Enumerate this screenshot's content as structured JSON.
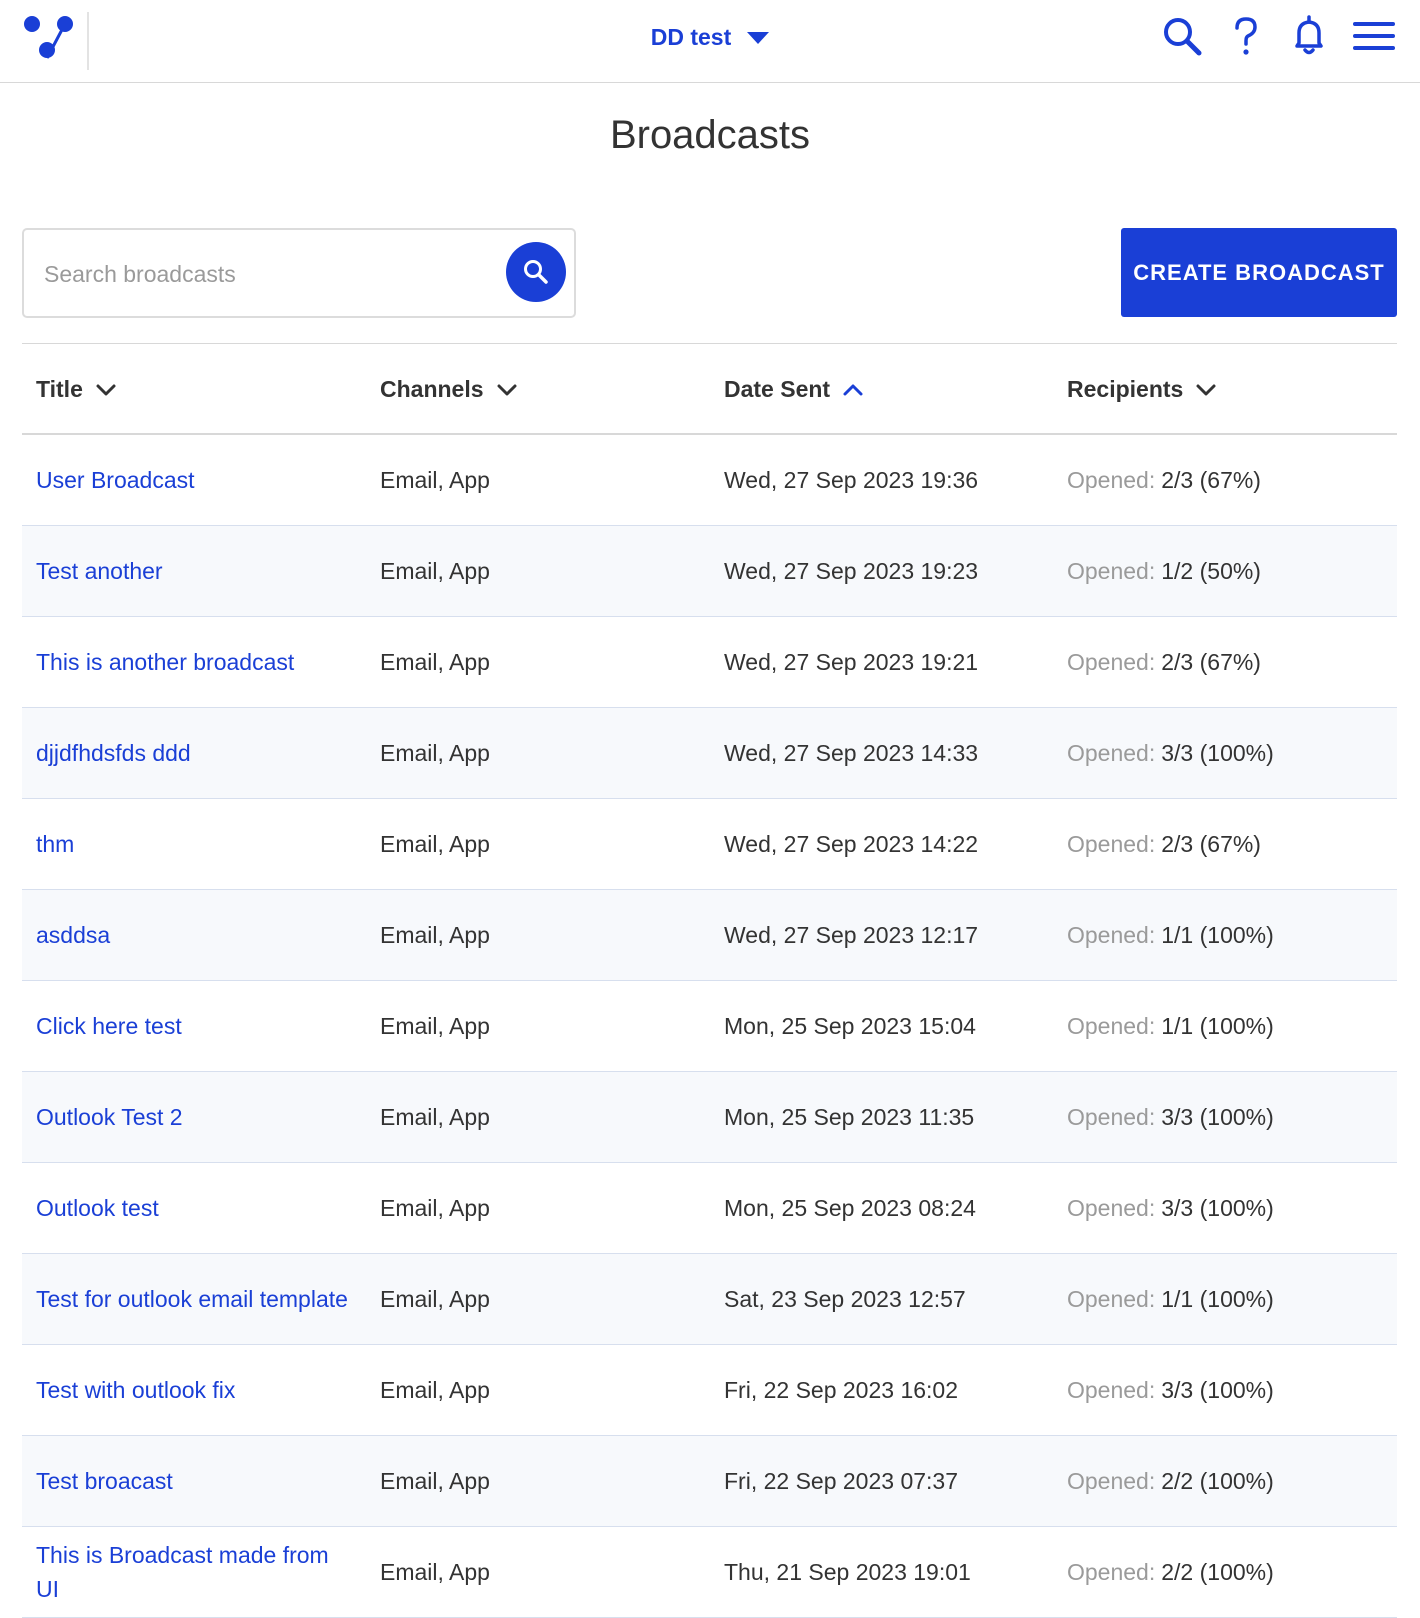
{
  "header": {
    "workspace": "DD test",
    "colors": {
      "accent": "#1a3fd6"
    },
    "icons": [
      "logo-icon",
      "search-icon",
      "help-icon",
      "bell-icon",
      "menu-icon"
    ]
  },
  "page": {
    "title": "Broadcasts",
    "search_placeholder": "Search broadcasts",
    "search_value": "",
    "create_label": "CREATE BROADCAST"
  },
  "table": {
    "columns": {
      "title": "Title",
      "channels": "Channels",
      "date_sent": "Date Sent",
      "recipients": "Recipients"
    },
    "rows": [
      {
        "title": "User Broadcast",
        "channels": "Email, App",
        "date": "Wed, 27 Sep 2023 19:36",
        "opened_label": "Opened:",
        "opened": "2/3 (67%)"
      },
      {
        "title": "Test another",
        "channels": "Email, App",
        "date": "Wed, 27 Sep 2023 19:23",
        "opened_label": "Opened:",
        "opened": "1/2 (50%)"
      },
      {
        "title": "This is another broadcast",
        "channels": "Email, App",
        "date": "Wed, 27 Sep 2023 19:21",
        "opened_label": "Opened:",
        "opened": "2/3 (67%)"
      },
      {
        "title": "djjdfhdsfds ddd",
        "channels": "Email, App",
        "date": "Wed, 27 Sep 2023 14:33",
        "opened_label": "Opened:",
        "opened": "3/3 (100%)"
      },
      {
        "title": "thm",
        "channels": "Email, App",
        "date": "Wed, 27 Sep 2023 14:22",
        "opened_label": "Opened:",
        "opened": "2/3 (67%)"
      },
      {
        "title": "asddsa",
        "channels": "Email, App",
        "date": "Wed, 27 Sep 2023 12:17",
        "opened_label": "Opened:",
        "opened": "1/1 (100%)"
      },
      {
        "title": "Click here test",
        "channels": "Email, App",
        "date": "Mon, 25 Sep 2023 15:04",
        "opened_label": "Opened:",
        "opened": "1/1 (100%)"
      },
      {
        "title": "Outlook Test 2",
        "channels": "Email, App",
        "date": "Mon, 25 Sep 2023 11:35",
        "opened_label": "Opened:",
        "opened": "3/3 (100%)"
      },
      {
        "title": "Outlook test",
        "channels": "Email, App",
        "date": "Mon, 25 Sep 2023 08:24",
        "opened_label": "Opened:",
        "opened": "3/3 (100%)"
      },
      {
        "title": "Test for outlook email template",
        "channels": "Email, App",
        "date": "Sat, 23 Sep 2023 12:57",
        "opened_label": "Opened:",
        "opened": "1/1 (100%)"
      },
      {
        "title": "Test with outlook fix",
        "channels": "Email, App",
        "date": "Fri, 22 Sep 2023 16:02",
        "opened_label": "Opened:",
        "opened": "3/3 (100%)"
      },
      {
        "title": "Test broacast",
        "channels": "Email, App",
        "date": "Fri, 22 Sep 2023 07:37",
        "opened_label": "Opened:",
        "opened": "2/2 (100%)"
      },
      {
        "title": "This is Broadcast made from UI",
        "channels": "Email, App",
        "date": "Thu, 21 Sep 2023 19:01",
        "opened_label": "Opened:",
        "opened": "2/2 (100%)"
      }
    ]
  }
}
